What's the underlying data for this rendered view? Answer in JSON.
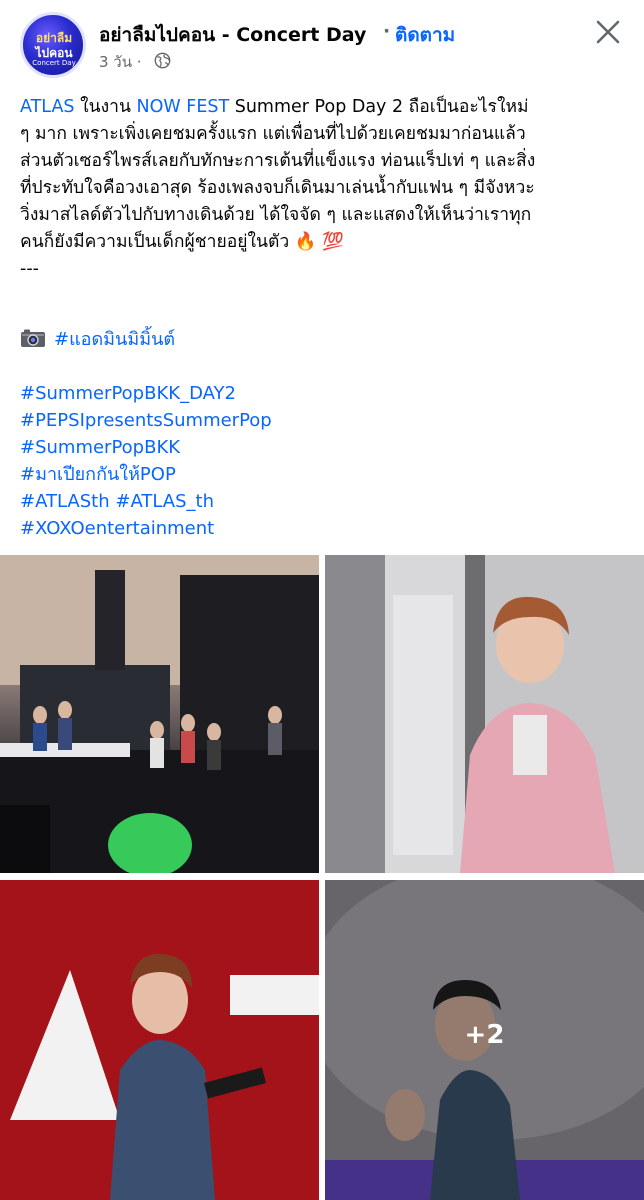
{
  "header": {
    "avatar_line1": "อย่าลืม",
    "avatar_line2": "ไปคอน",
    "avatar_line3": "Concert Day",
    "page_name": "อย่าลืมไปคอน - Concert Day",
    "separator": "·",
    "follow_label": "ติดตาม",
    "time": "3 วัน ·",
    "privacy_icon": "globe-icon",
    "close_icon": "close-icon"
  },
  "post": {
    "line1_link1": "ATLAS",
    "line1_mid": " ในงาน ",
    "line1_link2": "NOW FEST",
    "line1_rest": " Summer Pop Day 2 ถือเป็นอะไรใหม่",
    "line2": "ๆ มาก เพราะเพิ่งเคยชมครั้งแรก แต่เพื่อนที่ไปด้วยเคยชมมาก่อนแล้ว",
    "line3": "ส่วนตัวเซอร์ไพรส์เลยกับทักษะการเต้นที่แข็งแรง ท่อนแร็ปเท่ ๆ และสิ่ง",
    "line4": "ที่ประทับใจคือวงเอาสุด ร้องเพลงจบก็เดินมาเล่นน้ำกับแฟน ๆ มีจังหวะ",
    "line5": "วิ่งมาสไลด์ตัวไปกับทางเดินด้วย ได้ใจจัด ๆ และแสดงให้เห็นว่าเราทุก",
    "line6": "คนก็ยังมีความเป็นเด็กผู้ชายอยู่ในตัว 🔥 💯",
    "line7": "---"
  },
  "hashtags": {
    "camera_icon": "camera-icon",
    "admin": "#แอดมินมิมิ้นต์",
    "tags": [
      "#SummerPopBKK_DAY2",
      "#PEPSIpresentsSummerPop",
      "#SummerPopBKK",
      "#มาเปียกกันให้POP",
      "#ATLASth #ATLAS_th",
      "#XOXOentertainment"
    ]
  },
  "photos": {
    "more_count": "+2"
  }
}
